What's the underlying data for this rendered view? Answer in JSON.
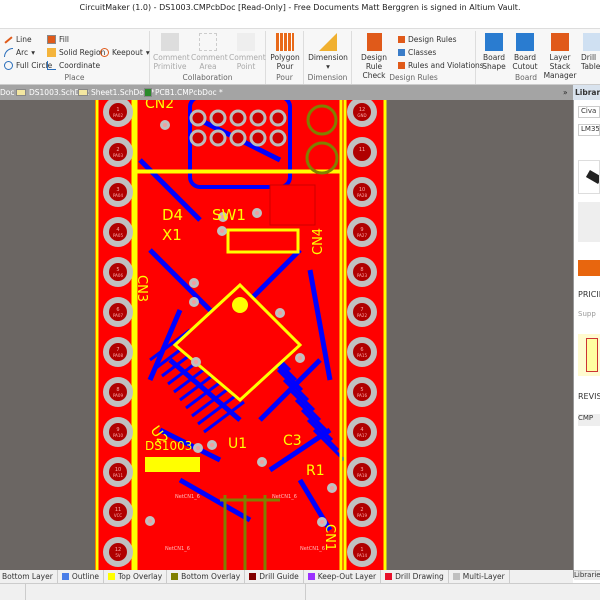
{
  "window": {
    "title": "CircuitMaker (1.0) - DS1003.CMPcbDoc [Read-Only] - Free Documents Matt Berggren is signed in Altium Vault."
  },
  "ribbon": {
    "place": {
      "label": "Place",
      "line": "Line",
      "arc": "Arc",
      "full_circle": "Full Circle",
      "fill": "Fill",
      "solid_region": "Solid Region",
      "coordinate": "Coordinate",
      "keepout": "Keepout"
    },
    "collaboration": {
      "label": "Collaboration",
      "comment_primitive": "Comment Primitive",
      "comment_area": "Comment Area",
      "comment_point": "Comment Point"
    },
    "pour": {
      "label": "Pour",
      "polygon_pour": "Polygon Pour"
    },
    "dimension": {
      "label": "Dimension",
      "dimension": "Dimension"
    },
    "design_rules": {
      "label": "Design Rules",
      "design_rule_check": "Design Rule Check",
      "design_rules": "Design Rules",
      "classes": "Classes",
      "rules_and_violations": "Rules and Violations"
    },
    "board": {
      "label": "Board",
      "board_shape": "Board Shape",
      "board_cutout": "Board Cutout",
      "layer_stack_manager": "Layer Stack Manager",
      "drill_table": "Drill Table"
    }
  },
  "tabs": [
    {
      "label": "Doc"
    },
    {
      "label": "DS1003.SchDoc"
    },
    {
      "label": "Sheet1.SchDoc *"
    },
    {
      "label": "PCB1.CMPcbDoc *"
    }
  ],
  "right_panel": {
    "title": "Libraries",
    "field1": "Civa",
    "field2": "LM353",
    "pricing": "PRICIN",
    "supplier": "Supp",
    "revisions": "REVIS",
    "rev_item": "CMP",
    "bottom_tab": "Librarie"
  },
  "pcb": {
    "designators": [
      "CN2",
      "D4",
      "X1",
      "SW1",
      "CN3",
      "CN4",
      "U2",
      "DS1003",
      "U1",
      "C3",
      "R1",
      "CN1"
    ],
    "left_pads": [
      {
        "n": "1",
        "s": "PA02"
      },
      {
        "n": "2",
        "s": "PA03"
      },
      {
        "n": "3",
        "s": "PA04"
      },
      {
        "n": "4",
        "s": "PA05"
      },
      {
        "n": "5",
        "s": "PA06"
      },
      {
        "n": "6",
        "s": "PA07"
      },
      {
        "n": "7",
        "s": "PA08"
      },
      {
        "n": "8",
        "s": "PA09"
      },
      {
        "n": "9",
        "s": "PA10"
      },
      {
        "n": "10",
        "s": "PA11"
      },
      {
        "n": "11",
        "s": "VCC"
      },
      {
        "n": "12",
        "s": "5V"
      }
    ],
    "right_pads": [
      {
        "n": "12",
        "s": "GND"
      },
      {
        "n": "11",
        "s": ""
      },
      {
        "n": "10",
        "s": "PA28"
      },
      {
        "n": "9",
        "s": "PA27"
      },
      {
        "n": "8",
        "s": "PA23"
      },
      {
        "n": "7",
        "s": "PA22"
      },
      {
        "n": "6",
        "s": "PA15"
      },
      {
        "n": "5",
        "s": "PA16"
      },
      {
        "n": "4",
        "s": "PA17"
      },
      {
        "n": "3",
        "s": "PA18"
      },
      {
        "n": "2",
        "s": "PA19"
      },
      {
        "n": "1",
        "s": "PA14"
      }
    ],
    "net_labels": [
      "NetCN1_6",
      "NetCN1_6",
      "NetCN1_6",
      "NetCN1_6"
    ],
    "colors": {
      "top": "#ff0000",
      "bottom": "#0000ff",
      "overlay": "#ffff00",
      "bottom_overlay": "#808000"
    }
  },
  "layers": [
    {
      "label": "Bottom Layer",
      "color": "#0000ff"
    },
    {
      "label": "Outline",
      "color": "#4a7ee8"
    },
    {
      "label": "Top Overlay",
      "color": "#ffff00"
    },
    {
      "label": "Bottom Overlay",
      "color": "#808000"
    },
    {
      "label": "Drill Guide",
      "color": "#800000"
    },
    {
      "label": "Keep-Out Layer",
      "color": "#9b30ff"
    },
    {
      "label": "Drill Drawing",
      "color": "#e8102a"
    },
    {
      "label": "Multi-Layer",
      "color": "#c0c0c0"
    }
  ]
}
